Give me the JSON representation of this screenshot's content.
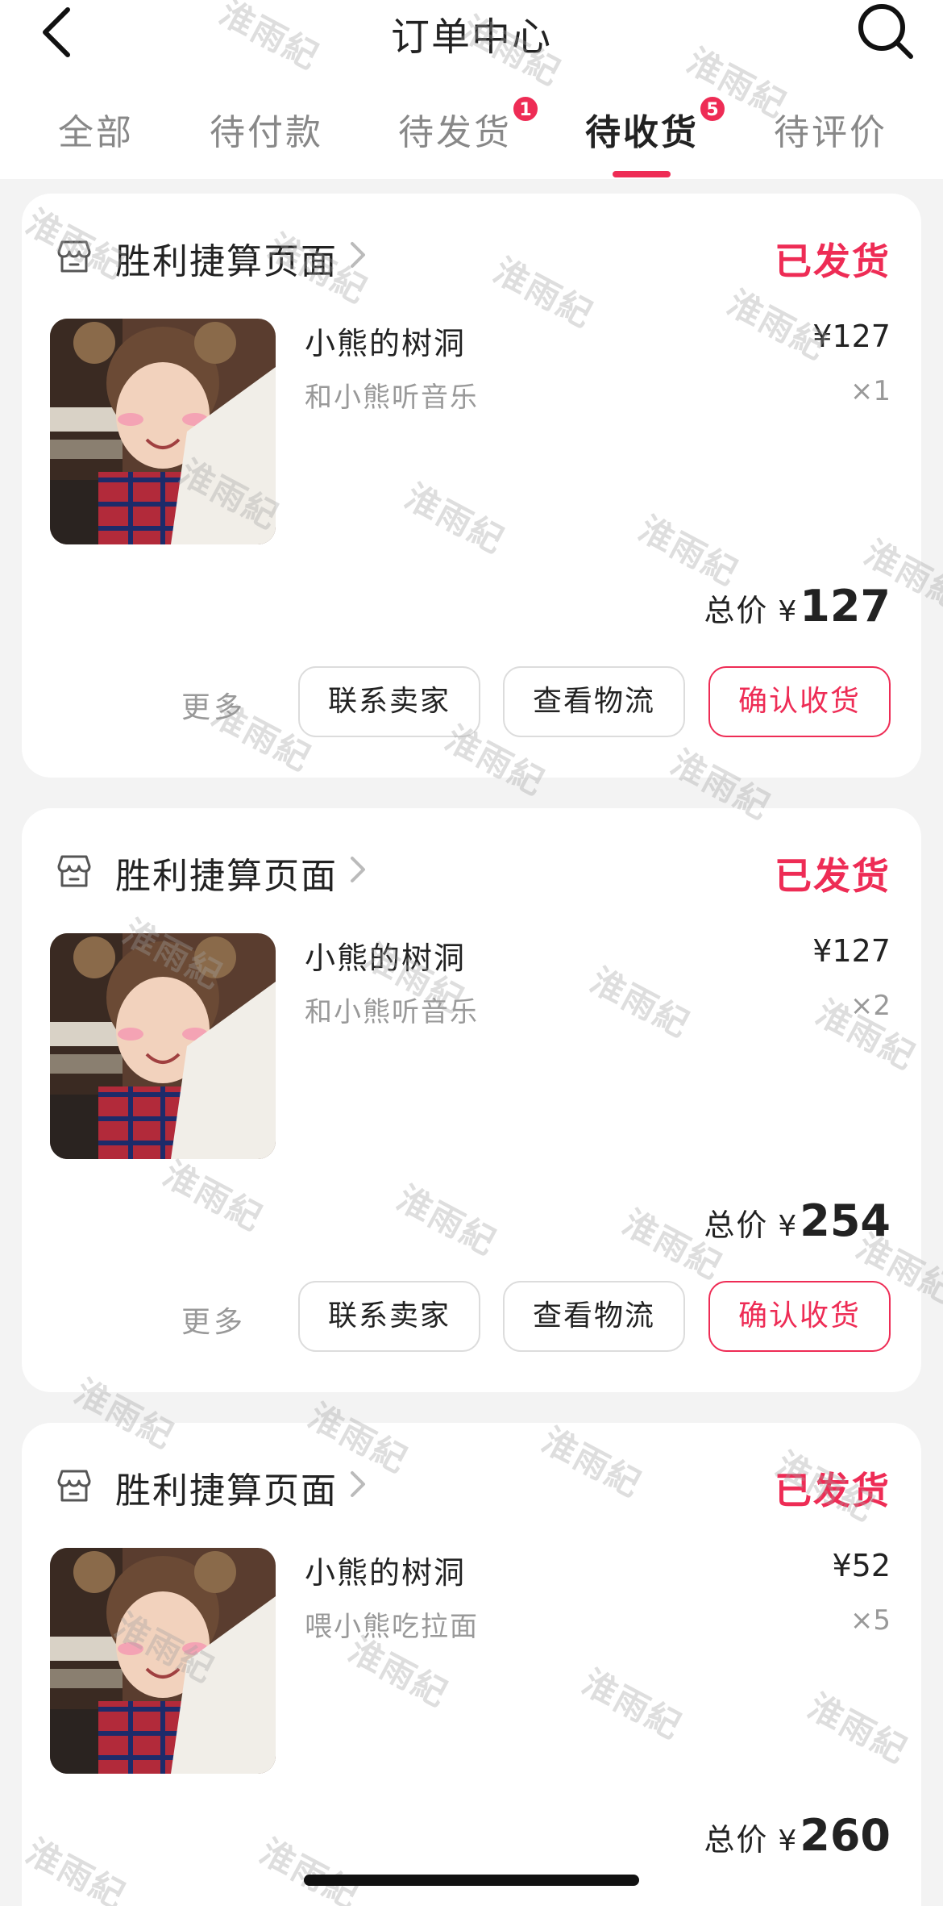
{
  "header": {
    "title": "订单中心",
    "back_icon": "chevron-left-icon",
    "search_icon": "search-icon"
  },
  "tabs": [
    {
      "label": "全部",
      "active": false
    },
    {
      "label": "待付款",
      "active": false
    },
    {
      "label": "待发货",
      "active": false,
      "badge": "1"
    },
    {
      "label": "待收货",
      "active": true,
      "badge": "5"
    },
    {
      "label": "待评价",
      "active": false
    }
  ],
  "colors": {
    "accent": "#ee2c55",
    "background": "#f3f3f3",
    "card": "#ffffff"
  },
  "orders": [
    {
      "store": "胜利捷算页面",
      "status": "已发货",
      "item_name": "小熊的树洞",
      "item_spec": "和小熊听音乐",
      "price": "¥127",
      "qty": "×1",
      "total_label": "总价",
      "currency": "¥",
      "total": "127",
      "more": "更多",
      "actions": [
        "联系卖家",
        "查看物流",
        "确认收货"
      ]
    },
    {
      "store": "胜利捷算页面",
      "status": "已发货",
      "item_name": "小熊的树洞",
      "item_spec": "和小熊听音乐",
      "price": "¥127",
      "qty": "×2",
      "total_label": "总价",
      "currency": "¥",
      "total": "254",
      "more": "更多",
      "actions": [
        "联系卖家",
        "查看物流",
        "确认收货"
      ]
    },
    {
      "store": "胜利捷算页面",
      "status": "已发货",
      "item_name": "小熊的树洞",
      "item_spec": "喂小熊吃拉面",
      "price": "¥52",
      "qty": "×5",
      "total_label": "总价",
      "currency": "¥",
      "total": "260"
    }
  ],
  "watermark": "淮雨紀"
}
